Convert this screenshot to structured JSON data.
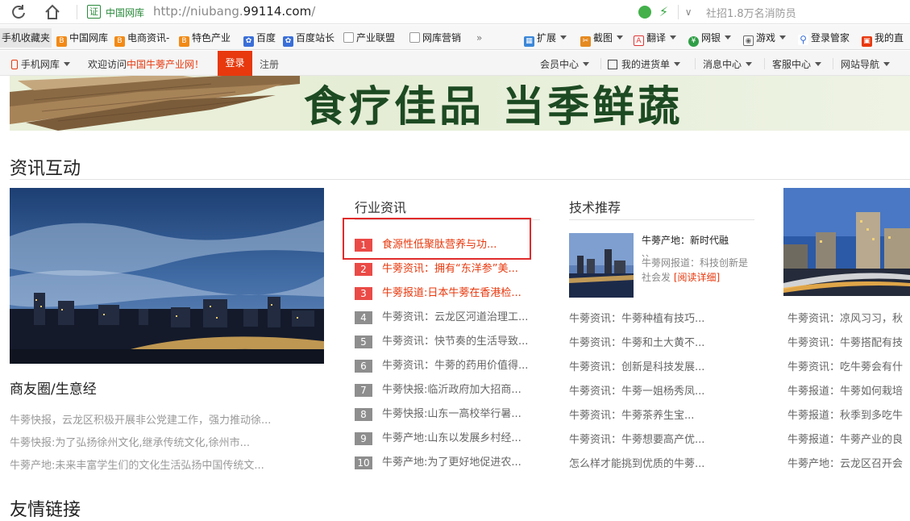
{
  "browser": {
    "site_badge": "证",
    "site_name": "中国网库",
    "url_prefix": "http://niubang.",
    "url_domain": "99114.com",
    "url_suffix": "/",
    "ad_text": "社招1.8万名消防员"
  },
  "bookmarks": [
    {
      "label": "手机收藏夹"
    },
    {
      "label": "中国网库",
      "icon": "B"
    },
    {
      "label": "电商资讯-",
      "icon": "B"
    },
    {
      "label": "特色产业",
      "icon": "B"
    },
    {
      "label": "百度",
      "icon": "paw-icon"
    },
    {
      "label": "百度站长",
      "icon": "paw-icon"
    },
    {
      "label": "产业联盟",
      "icon": "page-icon"
    },
    {
      "label": "网库营销",
      "icon": "page-icon"
    },
    {
      "label": "»"
    },
    {
      "label": "扩展",
      "icon": "extensions-icon"
    },
    {
      "label": "截图",
      "icon": "screenshot-icon"
    },
    {
      "label": "翻译",
      "icon": "translate-icon"
    },
    {
      "label": "网银",
      "icon": "bank-icon"
    },
    {
      "label": "游戏",
      "icon": "game-icon"
    },
    {
      "label": "登录管家",
      "icon": "key-icon"
    },
    {
      "label": "我的直",
      "icon": "tv-icon"
    }
  ],
  "topbar": {
    "mobile": "手机网库",
    "welcome_prefix": "欢迎访问",
    "welcome_site": "中国牛蒡产业网",
    "welcome_suffix": "！",
    "login": "登录",
    "register": "注册",
    "right_menus": [
      "会员中心",
      "我的进货单",
      "消息中心",
      "客服中心",
      "网站导航"
    ]
  },
  "banner": {
    "text": "食疗佳品 当季鲜蔬"
  },
  "section": {
    "title": "资讯互动",
    "left": {
      "sub_title": "商友圈/生意经",
      "news": [
        "牛蒡快报，云龙区积极开展非公党建工作，强力推动徐...",
        "牛蒡快报:为了弘扬徐州文化,继承传统文化,徐州市...",
        "牛蒡产地:未来丰富学生们的文化生活弘扬中国传统文..."
      ]
    },
    "industry": {
      "title": "行业资讯",
      "items": [
        {
          "num": "1",
          "text": "食源性低聚肽营养与功...",
          "hot": true
        },
        {
          "num": "2",
          "text": "牛蒡资讯：拥有“东洋参”美...",
          "hot": true
        },
        {
          "num": "3",
          "text": "牛蒡报道:日本牛蒡在香港检...",
          "hot": true
        },
        {
          "num": "4",
          "text": "牛蒡资讯：云龙区河道治理工...",
          "hot": false
        },
        {
          "num": "5",
          "text": "牛蒡资讯：快节奏的生活导致...",
          "hot": false
        },
        {
          "num": "6",
          "text": "牛蒡资讯：牛蒡的药用价值得...",
          "hot": false
        },
        {
          "num": "7",
          "text": "牛蒡快报:临沂政府加大招商...",
          "hot": false
        },
        {
          "num": "8",
          "text": "牛蒡快报:山东一高校举行暑...",
          "hot": false
        },
        {
          "num": "9",
          "text": "牛蒡产地:山东以发展乡村经...",
          "hot": false
        },
        {
          "num": "10",
          "text": "牛蒡产地:为了更好地促进农...",
          "hot": false
        }
      ]
    },
    "tech": {
      "title": "技术推荐",
      "feature_head": "牛蒡产地：新时代融",
      "feature_dots": "、、",
      "feature_desc": "牛蒡网报道：科技创新是社会发",
      "feature_link": "[阅读详细]",
      "news": [
        "牛蒡资讯：牛蒡种植有技巧...",
        "牛蒡资讯：牛蒡和土大黄不...",
        "牛蒡资讯：创新是科技发展...",
        "牛蒡资讯：牛蒡一姐杨秀凤...",
        "牛蒡资讯：牛蒡茶养生宝...",
        "牛蒡资讯：牛蒡想要高产优...",
        "怎么样才能挑到优质的牛蒡..."
      ]
    },
    "right": {
      "news": [
        "牛蒡资讯：凉风习习，秋",
        "牛蒡资讯：牛蒡搭配有技",
        "牛蒡资讯：吃牛蒡会有什",
        "牛蒡报道：牛蒡如何栽培",
        "牛蒡报道：秋季到多吃牛",
        "牛蒡报道：牛蒡产业的良",
        "牛蒡产地：云龙区召开会"
      ]
    }
  },
  "friend_links": {
    "title": "友情链接"
  }
}
